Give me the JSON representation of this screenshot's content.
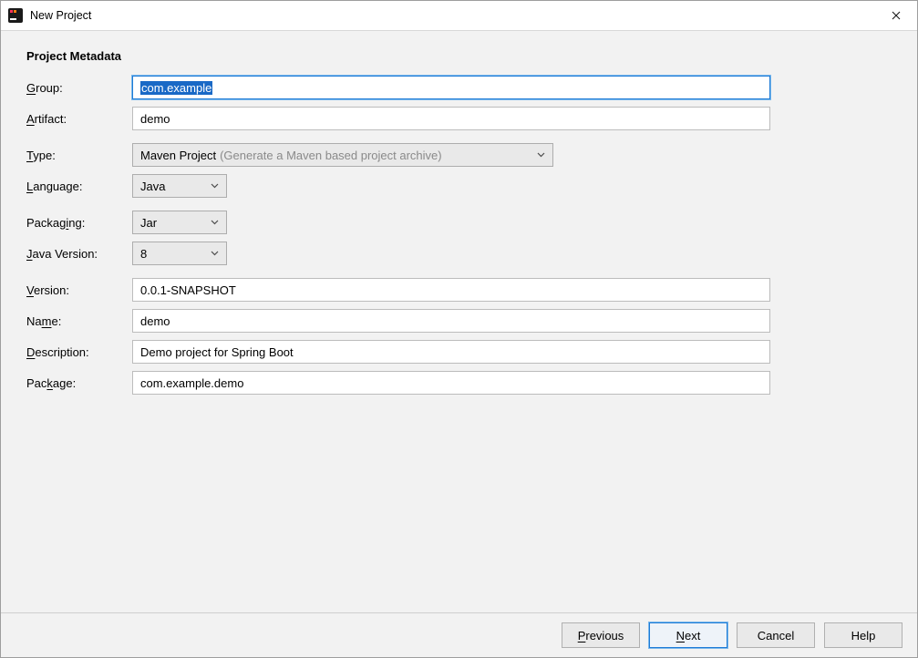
{
  "window": {
    "title": "New Project"
  },
  "section": {
    "title": "Project Metadata"
  },
  "labels": {
    "group": {
      "pre": "",
      "u": "G",
      "post": "roup:"
    },
    "artifact": {
      "pre": "",
      "u": "A",
      "post": "rtifact:"
    },
    "type": {
      "pre": "",
      "u": "T",
      "post": "ype:"
    },
    "language": {
      "pre": "",
      "u": "L",
      "post": "anguage:"
    },
    "packaging": {
      "pre": "Packag",
      "u": "i",
      "post": "ng:"
    },
    "java_version": {
      "pre": "",
      "u": "J",
      "post": "ava Version:"
    },
    "version": {
      "pre": "",
      "u": "V",
      "post": "ersion:"
    },
    "name": {
      "pre": "Na",
      "u": "m",
      "post": "e:"
    },
    "description": {
      "pre": "",
      "u": "D",
      "post": "escription:"
    },
    "package": {
      "pre": "Pac",
      "u": "k",
      "post": "age:"
    }
  },
  "fields": {
    "group": "com.example",
    "artifact": "demo",
    "type": {
      "value": "Maven Project",
      "hint": "(Generate a Maven based project archive)"
    },
    "language": "Java",
    "packaging": "Jar",
    "java_version": "8",
    "version": "0.0.1-SNAPSHOT",
    "name": "demo",
    "description": "Demo project for Spring Boot",
    "package": "com.example.demo"
  },
  "buttons": {
    "previous": {
      "pre": "",
      "u": "P",
      "post": "revious"
    },
    "next": {
      "pre": "",
      "u": "N",
      "post": "ext"
    },
    "cancel": "Cancel",
    "help": "Help"
  }
}
